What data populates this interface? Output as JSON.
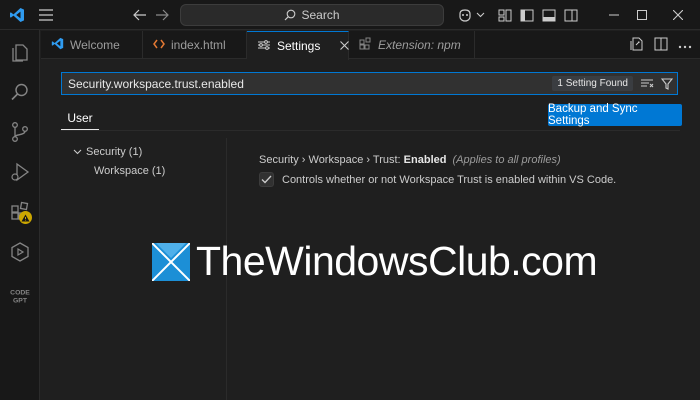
{
  "titlebar": {
    "search_label": "Search",
    "icons": [
      "vscode-logo-icon",
      "menu-icon",
      "back-arrow-icon",
      "forward-arrow-icon",
      "search-icon",
      "copilot-icon",
      "chevron-down-icon",
      "layout-panel-icon",
      "layout-sidebar-icon",
      "layout-secondary-icon",
      "customize-layout-icon",
      "minimize-icon",
      "maximize-icon",
      "close-icon"
    ]
  },
  "activitybar": {
    "items": [
      "explorer-icon",
      "search-icon",
      "source-control-icon",
      "run-debug-icon",
      "extensions-icon",
      "remote-play-icon",
      "codegpt-icon"
    ],
    "codegpt_label": "CODE GPT"
  },
  "tabs": [
    {
      "label": "Welcome",
      "icon": "vscode-logo-icon",
      "active": false
    },
    {
      "label": "index.html",
      "icon": "html-icon",
      "active": false
    },
    {
      "label": "Settings",
      "icon": "settings-gear-icon",
      "active": true
    },
    {
      "label": "Extension: npm",
      "icon": "extension-icon",
      "active": false
    }
  ],
  "settings": {
    "search_value": "Security.workspace.trust.enabled",
    "found_badge": "1 Setting Found",
    "scope_tab": "User",
    "sync_button": "Backup and Sync Settings",
    "toc": [
      {
        "label": "Security (1)",
        "expanded": true
      },
      {
        "label": "Workspace (1)"
      }
    ],
    "setting": {
      "breadcrumb": "Security › Workspace › Trust: ",
      "name": "Enabled",
      "scope_note": "(Applies to all profiles)",
      "description": "Controls whether or not Workspace Trust is enabled within VS Code.",
      "checked": true
    }
  },
  "watermark": {
    "text": "TheWindowsClub.com"
  },
  "colors": {
    "accent": "#0078d4",
    "warning": "#cca700",
    "background": "#1f1f1f",
    "chrome": "#181818"
  }
}
